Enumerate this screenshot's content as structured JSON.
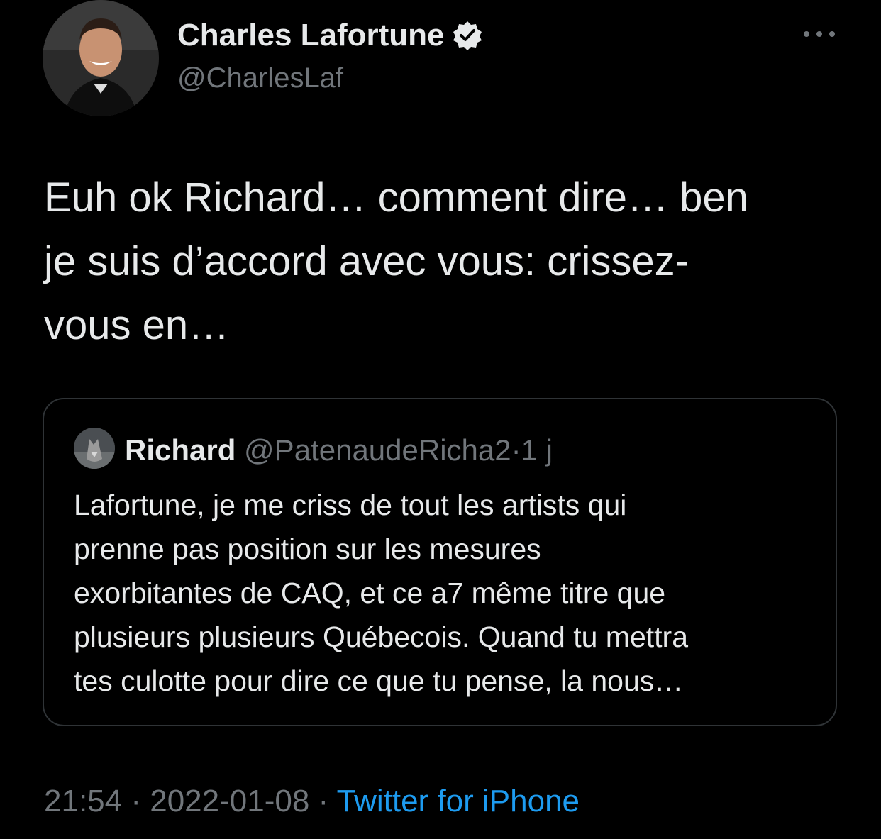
{
  "author": {
    "display_name": "Charles Lafortune",
    "handle": "@CharlesLaf",
    "avatar_icon": "profile-photo",
    "verified_icon": "verified-badge-icon"
  },
  "tweet": {
    "text_lines": [
      "Euh ok Richard… comment dire… ben",
      "je suis d’accord avec vous: crissez-",
      "vous en…"
    ]
  },
  "quoted": {
    "display_name": "Richard",
    "handle": "@PatenaudeRicha2",
    "separator": "·",
    "time": "1 j",
    "text_lines": [
      "Lafortune, je me criss de tout les artists qui",
      "prenne pas position sur les mesures",
      "exorbitantes de CAQ, et ce a7 même titre que",
      "plusieurs plusieurs Québecois.  Quand tu mettra",
      "tes culotte pour dire ce que tu pense, la nous…"
    ]
  },
  "meta": {
    "time": "21:54",
    "separator": "·",
    "date": "2022-01-08",
    "source": "Twitter for iPhone"
  },
  "colors": {
    "background": "#000000",
    "text": "#e7e9ea",
    "secondary": "#71767b",
    "accent": "#1d9bf0",
    "border": "#2f3336"
  }
}
